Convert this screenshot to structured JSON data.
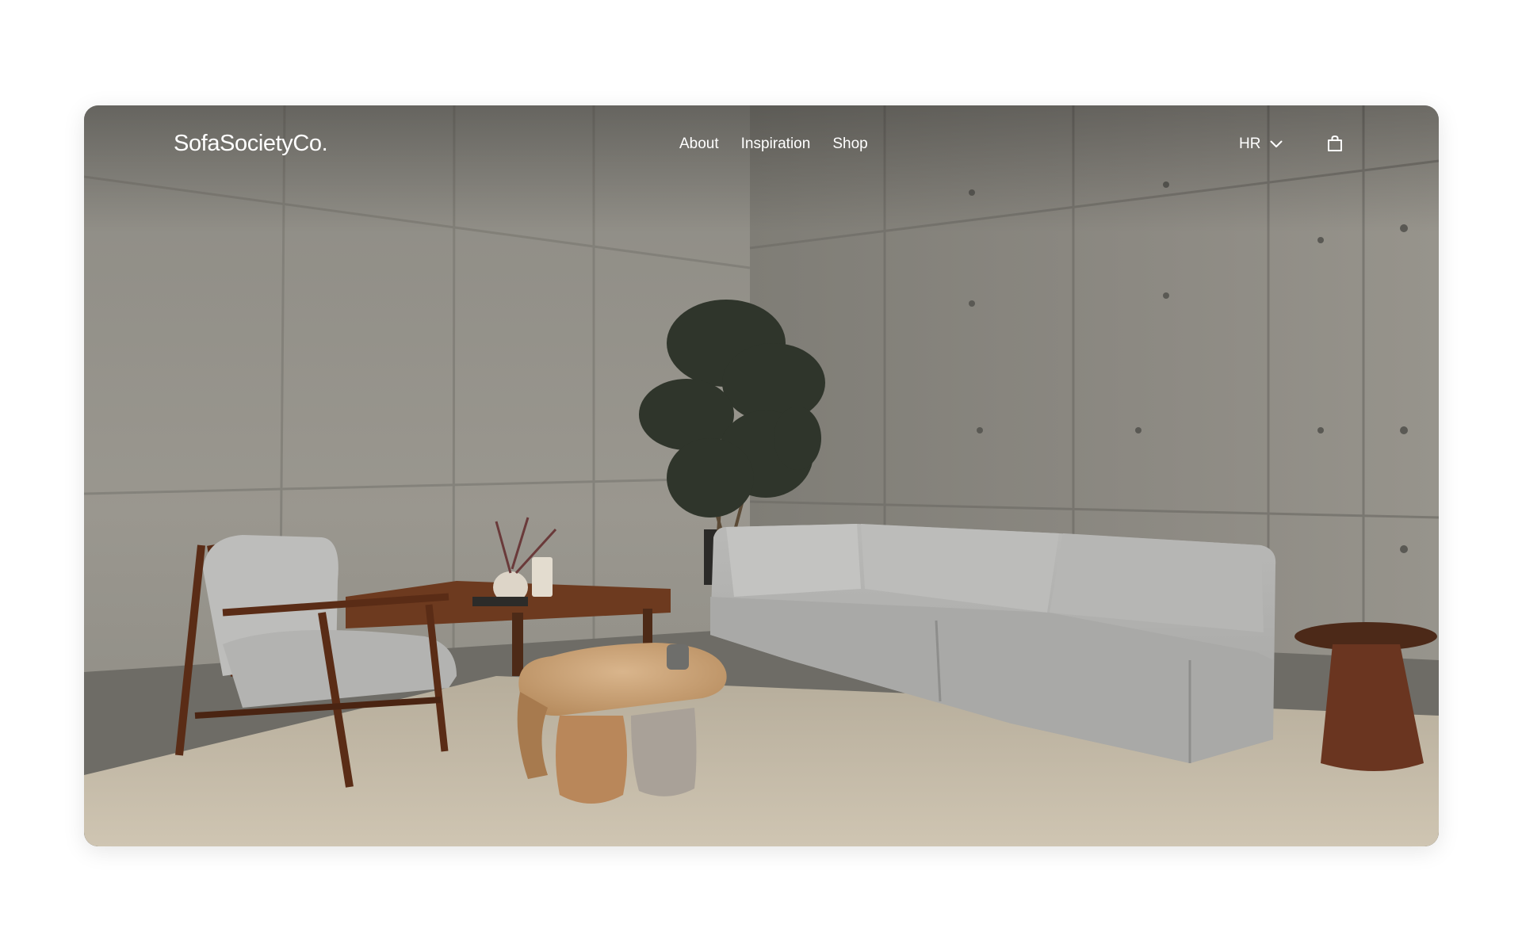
{
  "header": {
    "logo": "SofaSocietyCo.",
    "nav": [
      {
        "label": "About"
      },
      {
        "label": "Inspiration"
      },
      {
        "label": "Shop"
      }
    ],
    "region": "HR",
    "icons": {
      "region_toggle": "chevron-down-icon",
      "cart": "shopping-bag-icon"
    }
  },
  "hero": {
    "image": "living-room-scene"
  }
}
